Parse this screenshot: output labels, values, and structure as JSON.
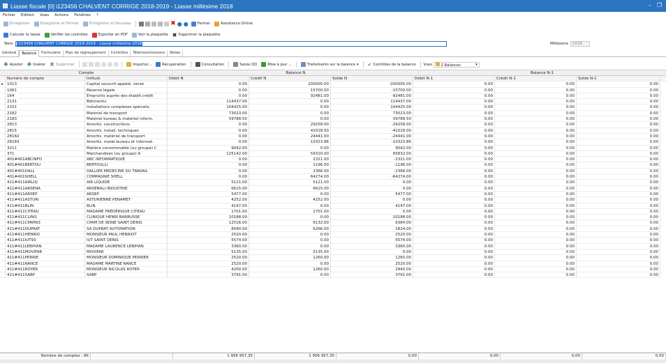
{
  "window": {
    "title": "Liasse fiscale [0] i123456 CHALVENT CORRIGE 2018-2019 - Liasse millésime 2018"
  },
  "menu": [
    "Fichier",
    "Edition",
    "Vues",
    "Actions",
    "Fenêtres",
    "?"
  ],
  "toolbar1": [
    "Enregistrer",
    "Enregistrer et Fermer",
    "Enregistrer et Nouveau",
    "Fermer",
    "Assistance Online"
  ],
  "toolbar2": [
    "Calculer la liasse",
    "Vérifier les contrôles",
    "Exporter en PDF",
    "Voir la plaquette",
    "Supprimer la plaquette"
  ],
  "nom": {
    "label": "Nom",
    "value": "i123456 CHALVENT CORRIGE 2018-2019 - Liasse millésime 2018",
    "millesime_label": "Millésime",
    "millesime_value": "2018"
  },
  "tabs": [
    "Général",
    "Balance",
    "Formulaire",
    "Plan de regroupement",
    "Contrôles",
    "Télétransmissions",
    "Notes"
  ],
  "grid_toolbar": {
    "ajouter": "Ajouter",
    "inserer": "Insérer",
    "supprimer": "Supprimer",
    "importer": "Importer...",
    "recuperation": "Récupération",
    "consultation": "Consultation",
    "saisie_od": "Saisie OD",
    "mise_a_jour": "Mise à jour ...",
    "traitements": "Traitements sur la balance",
    "controles": "Contrôles de la balance",
    "vues": "Vues",
    "vues_value": "2 Balances"
  },
  "grid": {
    "groups": [
      "Compte",
      "Balance N",
      "Balance N-1"
    ],
    "columns": [
      "Numéro de compte",
      "Intitulé",
      "Débit N",
      "Crédit N",
      "Solde N",
      "Débit N-1",
      "Crédit N-1",
      "Solde N-1"
    ],
    "rows": [
      [
        "1013",
        "Capital souscrit-appelé, versé",
        "0.00",
        "200000.00",
        "-200000.00",
        "0.00",
        "0.00",
        "0.00"
      ],
      [
        "1061",
        "Réserve légale",
        "0.00",
        "15700.00",
        "-15700.00",
        "0.00",
        "0.00",
        "0.00"
      ],
      [
        "164",
        "Emprunts auprès des établit.crédit",
        "0.00",
        "92481.00",
        "-92481.00",
        "0.00",
        "0.00",
        "0.00"
      ],
      [
        "2131",
        "Bâtiments",
        "114437.00",
        "0.00",
        "114437.00",
        "0.00",
        "0.00",
        "0.00"
      ],
      [
        "2151",
        "Installations complexes spécialis.",
        "104425.00",
        "0.00",
        "104425.00",
        "0.00",
        "0.00",
        "0.00"
      ],
      [
        "2182",
        "Matériel de transport",
        "73023.00",
        "0.00",
        "73023.00",
        "0.00",
        "0.00",
        "0.00"
      ],
      [
        "2183",
        "Matériel bureau & matériel inform.",
        "59788.50",
        "0.00",
        "59788.50",
        "0.00",
        "0.00",
        "0.00"
      ],
      [
        "2813",
        "Amortis. constructions",
        "0.00",
        "29258.00",
        "-29258.00",
        "0.00",
        "0.00",
        "0.00"
      ],
      [
        "2815",
        "Amortis. install. techniques",
        "0.00",
        "41018.00",
        "-41018.00",
        "0.00",
        "0.00",
        "0.00"
      ],
      [
        "28182",
        "Amortis. matériel de transport",
        "0.00",
        "24441.00",
        "-24441.00",
        "0.00",
        "0.00",
        "0.00"
      ],
      [
        "28183",
        "Amortis. matér.bureau et informat.",
        "0.00",
        "10323.86",
        "-10323.86",
        "0.00",
        "0.00",
        "0.00"
      ],
      [
        "3211",
        "Matière consommable (ou groupe) C",
        "9042.00",
        "0.00",
        "9042.00",
        "0.00",
        "0.00",
        "0.00"
      ],
      [
        "371",
        "Marchandises (ou groupe) A",
        "125142.00",
        "59310.00",
        "65832.00",
        "0.00",
        "0.00",
        "0.00"
      ],
      [
        "401#401ABCINFO",
        "ABC INFORMATIQUE",
        "0.00",
        "2321.00",
        "-2321.00",
        "0.00",
        "0.00",
        "0.00"
      ],
      [
        "401#401BERTOU",
        "BERTOULLI",
        "0.00",
        "1196.00",
        "-1196.00",
        "0.00",
        "0.00",
        "0.00"
      ],
      [
        "401#401DALL",
        "DALLIER MEDECINE DU TRAVAIL",
        "0.00",
        "2366.00",
        "-2366.00",
        "0.00",
        "0.00",
        "0.00"
      ],
      [
        "401#401SHELL",
        "COMPAGNIE SHELL",
        "0.00",
        "64274.00",
        "-64274.00",
        "0.00",
        "0.00",
        "0.00"
      ],
      [
        "411#411AIRLIQ",
        "AIR LIQUIDE",
        "5121.00",
        "5121.00",
        "0.00",
        "0.00",
        "0.00",
        "0.00"
      ],
      [
        "411#411ARSENA",
        "ARSENALI INDUSTRIE",
        "6615.00",
        "6615.00",
        "0.00",
        "0.00",
        "0.00",
        "0.00"
      ],
      [
        "411#411ARSEP",
        "ARSEP",
        "5477.00",
        "0.00",
        "5477.00",
        "0.00",
        "0.00",
        "0.00"
      ],
      [
        "411#411ASTURI",
        "ASTURIENNE PENAMET",
        "4252.00",
        "4252.00",
        "0.00",
        "0.00",
        "0.00",
        "0.00"
      ],
      [
        "411#411BLIN",
        "BLIN",
        "4147.00",
        "0.00",
        "4147.00",
        "0.00",
        "0.00",
        "0.00"
      ],
      [
        "411#411CITEAU",
        "MADAME FRÉDÉRIQUE CITEAU",
        "1701.00",
        "1701.00",
        "0.00",
        "0.00",
        "0.00",
        "0.00"
      ],
      [
        "411#411CLINI1",
        "CLINIQUE HENRI BARBUSSE",
        "10188.00",
        "0.00",
        "10188.00",
        "0.00",
        "0.00",
        "0.00"
      ],
      [
        "411#411CPAM93",
        "CPAM DE SEINE SAINT DENIS",
        "12516.00",
        "6132.00",
        "6384.00",
        "0.00",
        "0.00",
        "0.00"
      ],
      [
        "411#411DUPRAT",
        "SA DUPRAT AUTOMATION",
        "8090.00",
        "6266.00",
        "1824.00",
        "0.00",
        "0.00",
        "0.00"
      ],
      [
        "411#411HENRIO",
        "MONSIEUR PAUL HENRIOT",
        "2520.00",
        "0.00",
        "2520.00",
        "0.00",
        "0.00",
        "0.00"
      ],
      [
        "411#411IUT93",
        "IUT SAINT DENIS",
        "5574.00",
        "0.00",
        "5574.00",
        "0.00",
        "0.00",
        "0.00"
      ],
      [
        "411#411LEBIHAN",
        "MADAME LAURENCE LEBIHAN",
        "3360.00",
        "0.00",
        "3360.00",
        "0.00",
        "0.00",
        "0.00"
      ],
      [
        "411#411MOVIFAR",
        "MOVIFAR",
        "5135.00",
        "5135.00",
        "0.00",
        "0.00",
        "0.00",
        "0.00"
      ],
      [
        "411#411PERRIE",
        "MONSIEUR DOMINIQUE PERRIER",
        "2520.00",
        "1260.00",
        "1260.00",
        "0.00",
        "0.00",
        "0.00"
      ],
      [
        "411#411RANCE",
        "MADAME MARTINE RANCE",
        "2520.00",
        "0.00",
        "2520.00",
        "0.00",
        "0.00",
        "0.00"
      ],
      [
        "411#411ROYER",
        "MONSIEUR NICOLAS ROYER",
        "4200.00",
        "1260.00",
        "2940.00",
        "0.00",
        "0.00",
        "0.00"
      ],
      [
        "411#411SABP",
        "SABP",
        "3791.00",
        "0.00",
        "3791.00",
        "0.00",
        "0.00",
        "0.00"
      ]
    ]
  },
  "footer": {
    "count": "Nombre de comptes : 86",
    "debit": "1 956 957,35",
    "credit": "1 956 957,35",
    "solde": "0,00",
    "debit1": "0,00",
    "credit1": "0,00",
    "solde1": "0,00"
  }
}
